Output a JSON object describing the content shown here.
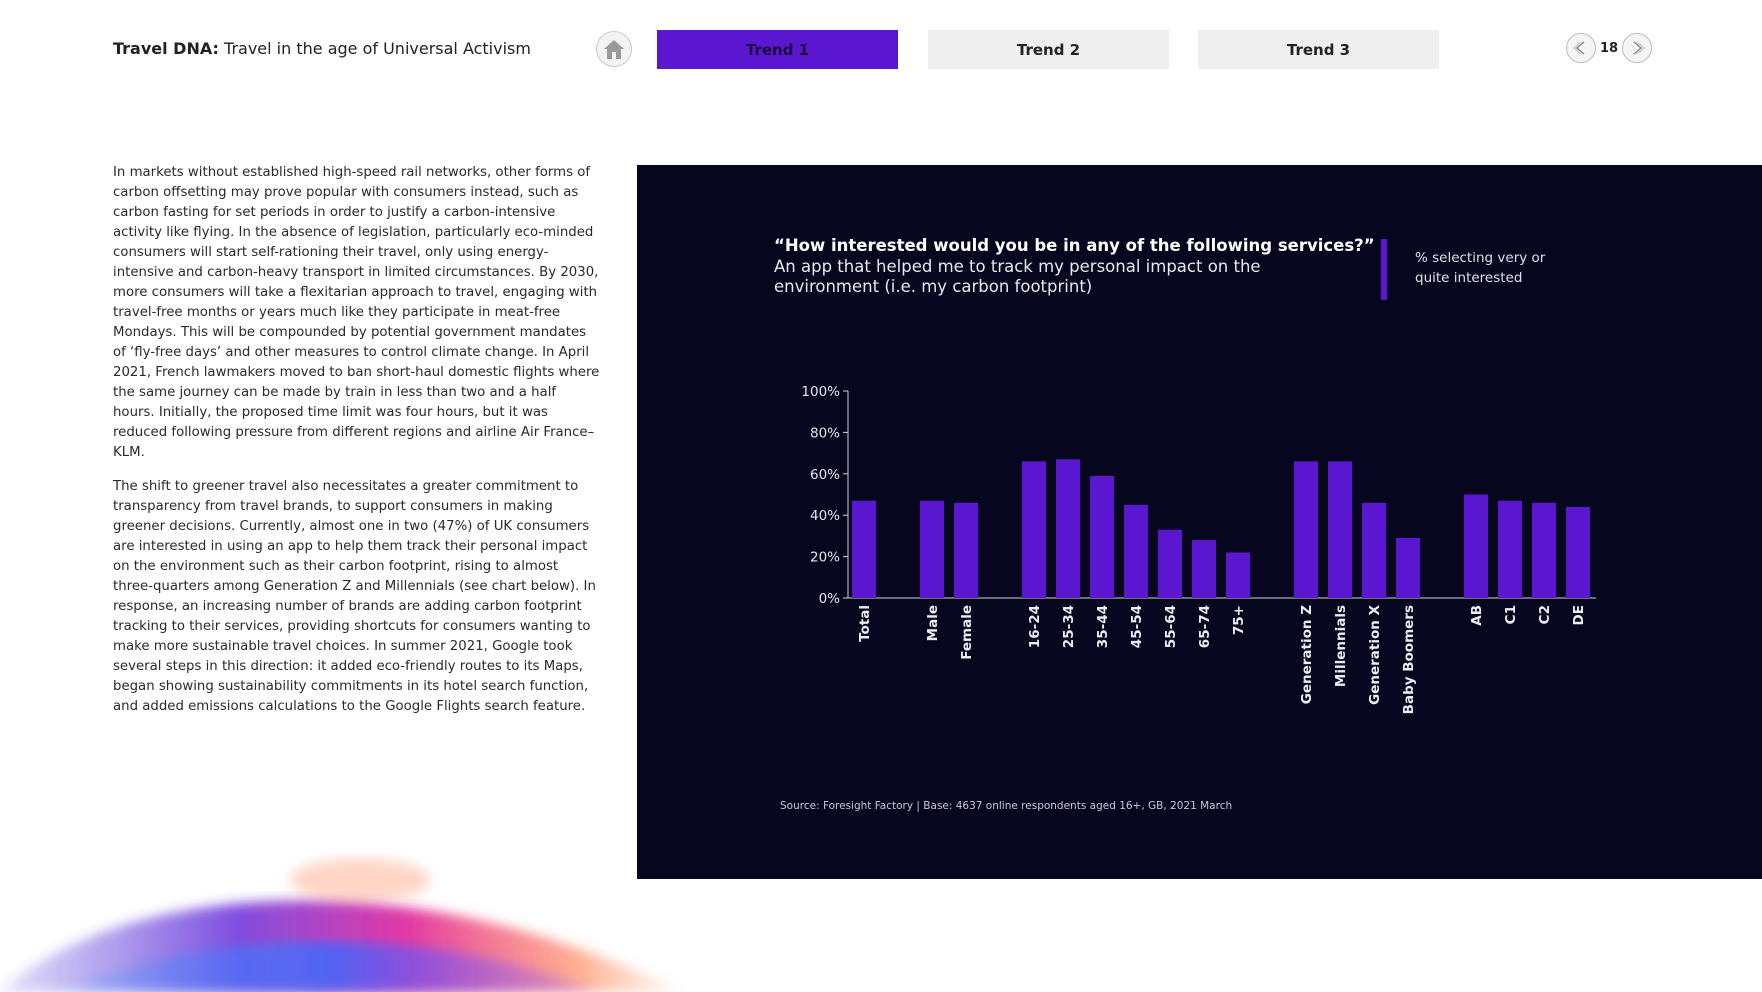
{
  "header": {
    "title_bold": "Travel DNA:",
    "title_rest": " Travel in the age of Universal Activism",
    "home_icon": "home-icon",
    "tabs": [
      {
        "label": "Trend 1",
        "active": true
      },
      {
        "label": "Trend 2",
        "active": false
      },
      {
        "label": "Trend 3",
        "active": false
      }
    ],
    "page_number": "18",
    "prev_icon": "chevron-left-icon",
    "next_icon": "chevron-right-icon"
  },
  "body": {
    "paragraphs": [
      "In markets without established high-speed rail networks, other forms of carbon offsetting may prove popular with consumers instead, such as carbon fasting for set periods in order to justify a carbon-intensive activity like flying. In the absence of legislation, particularly eco-minded consumers will start self-rationing their travel, only using energy-intensive and carbon-heavy transport in limited circumstances. By 2030, more consumers will take a flexitarian approach to travel, engaging with travel-free months or years much like they participate in meat-free Mondays. This will be compounded by potential government mandates of ‘fly-free days’ and other measures to control climate change. In April 2021, French lawmakers moved to ban short-haul domestic flights where the same journey can be made by train in less than two and a half hours. Initially, the proposed time limit was four hours, but it was reduced following pressure from different regions and airline Air France–KLM.",
      "The shift to greener travel also necessitates a greater commitment to transparency from travel brands, to support consumers in making greener decisions. Currently, almost one in two (47%) of UK consumers are interested in using an app to help them track their personal impact on the environment such as their carbon footprint, rising to almost three-quarters among Generation Z and Millennials (see chart below). In response, an increasing number of brands are adding carbon footprint tracking to their services, providing shortcuts for consumers wanting to make more sustainable travel choices. In summer 2021, Google took several steps in this direction: it added eco-friendly routes to its Maps, began showing sustainability commitments in its hotel search function, and added emissions calculations to the Google Flights search feature."
    ]
  },
  "chart_data": {
    "type": "bar",
    "title": "“How interested would you be in any of the following services?”",
    "subtitle": "An app that helped me to track my personal impact on the environment (i.e. my carbon footprint)",
    "legend": "% selecting very or quite interested",
    "source": "Source: Foresight Factory | Base: 4637 online respondents aged 16+, GB, 2021 March",
    "y_ticks": [
      "0%",
      "20%",
      "40%",
      "60%",
      "80%",
      "100%"
    ],
    "ylim": [
      0,
      100
    ],
    "categories": [
      "Total",
      "Male",
      "Female",
      "16-24",
      "25-34",
      "35-44",
      "45-54",
      "55-64",
      "65-74",
      "75+",
      "Generation Z",
      "Millennials",
      "Generation X",
      "Baby Boomers",
      "AB",
      "C1",
      "C2",
      "DE"
    ],
    "groups": [
      [
        0
      ],
      [
        1,
        2
      ],
      [
        3,
        4,
        5,
        6,
        7,
        8,
        9
      ],
      [
        10,
        11,
        12,
        13
      ],
      [
        14,
        15,
        16,
        17
      ]
    ],
    "values": [
      47,
      47,
      46,
      66,
      67,
      59,
      45,
      33,
      28,
      22,
      66,
      66,
      46,
      29,
      50,
      47,
      46,
      44
    ],
    "bar_color": "#5b17cf",
    "axis_color": "#d0d0dc"
  }
}
